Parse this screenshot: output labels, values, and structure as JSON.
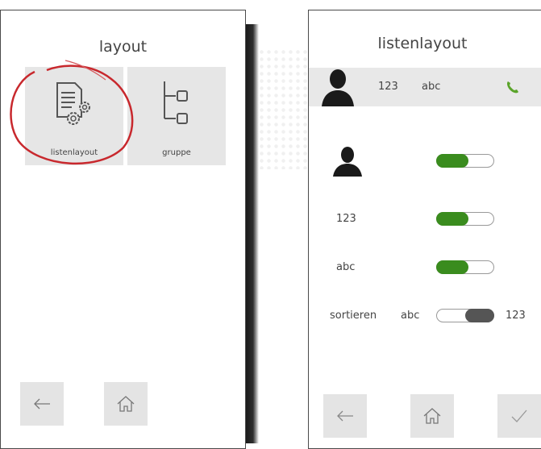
{
  "left_screen": {
    "title": "layout",
    "tiles": [
      {
        "label": "listenlayout",
        "icon": "document-settings-icon"
      },
      {
        "label": "gruppe",
        "icon": "tree-structure-icon"
      }
    ],
    "nav": [
      {
        "icon": "arrow-left-icon"
      },
      {
        "icon": "home-icon"
      }
    ]
  },
  "right_screen": {
    "title": "listenlayout",
    "preview_row": {
      "number": "123",
      "name": "abc",
      "icon": "phone-icon"
    },
    "rows": [
      {
        "icon": "person-icon",
        "state": "on"
      },
      {
        "label": "123",
        "state": "on"
      },
      {
        "label": "abc",
        "state": "on"
      },
      {
        "label": "sortieren",
        "left_value": "abc",
        "right_value": "123",
        "state": "right"
      }
    ],
    "nav": [
      {
        "icon": "arrow-left-icon"
      },
      {
        "icon": "home-icon"
      },
      {
        "icon": "checkmark-icon"
      }
    ]
  },
  "colors": {
    "accent_green": "#3a8c1e",
    "highlight_circle": "#c8282d",
    "tile_bg": "#e6e6e6"
  }
}
